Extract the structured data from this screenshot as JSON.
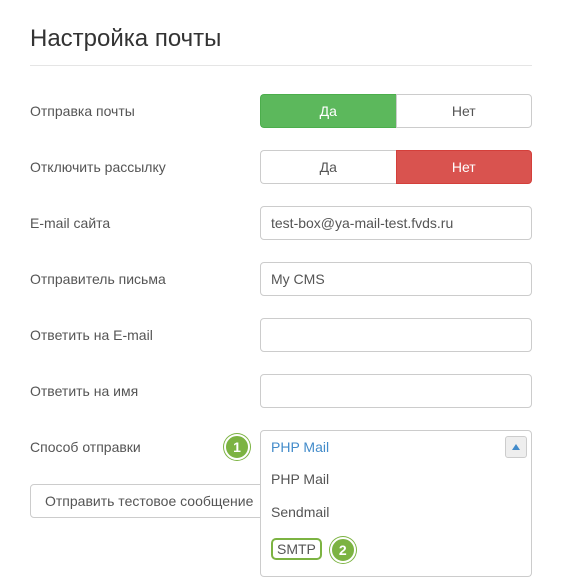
{
  "title": "Настройка почты",
  "labels": {
    "send_mail": "Отправка почты",
    "disable_mailing": "Отключить рассылку",
    "site_email": "E-mail сайта",
    "sender": "Отправитель письма",
    "reply_email": "Ответить на E-mail",
    "reply_name": "Ответить на имя",
    "send_method": "Способ отправки"
  },
  "toggle": {
    "yes": "Да",
    "no": "Нет"
  },
  "values": {
    "site_email": "test-box@ya-mail-test.fvds.ru",
    "sender": "My CMS",
    "reply_email": "",
    "reply_name": ""
  },
  "send_method": {
    "selected": "PHP Mail",
    "options": [
      "PHP Mail",
      "Sendmail",
      "SMTP"
    ]
  },
  "actions": {
    "test_send": "Отправить тестовое сообщение"
  },
  "callouts": {
    "one": "1",
    "two": "2"
  },
  "colors": {
    "accent_green": "#7cb342",
    "btn_green": "#5cb85c",
    "btn_red": "#d9534f",
    "link_blue": "#428bca"
  }
}
